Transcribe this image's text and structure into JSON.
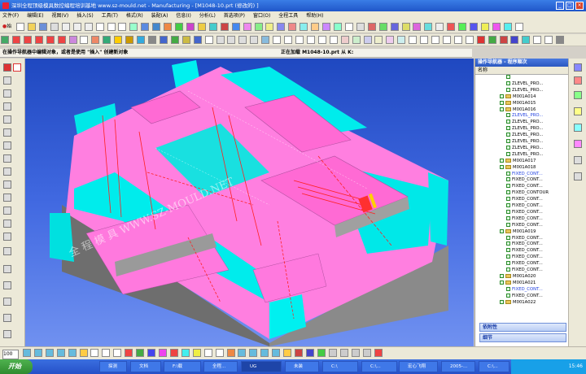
{
  "title_bar": {
    "text": "深圳全程顶级模具数控编程培训基地 www.sz-mould.net - Manufacturing - [M1048-10.prt (修改的) ]",
    "minimize": "_",
    "maximize": "□",
    "close": "×"
  },
  "menu": [
    "文件(F)",
    "编辑(E)",
    "视图(V)",
    "插入(S)",
    "工具(T)",
    "格式(R)",
    "装配(A)",
    "信息(I)",
    "分析(L)",
    "首选项(P)",
    "窗口(O)",
    "全程工具",
    "帮助(H)"
  ],
  "toolbar": {
    "start_label": "始",
    "zoom_value": "100"
  },
  "status": {
    "prompt": "在操作导航器中编辑对象，或者是使用 \"插入\" 创建新对象",
    "center": "正在加载 M1048-10.prt 从 K:"
  },
  "viewport": {
    "watermark": "全  程  模  具   WWW.SZ-MOULD.NET"
  },
  "navigator": {
    "title": "操作导航器 - 程序顺次",
    "col_name": "名称",
    "rows": [
      {
        "label": "",
        "kind": "op",
        "level": 3
      },
      {
        "label": "ZLEVEL_PRO...",
        "kind": "op",
        "level": 3
      },
      {
        "label": "ZLEVEL_PRO...",
        "kind": "op",
        "level": 3
      },
      {
        "label": "M001A014",
        "kind": "group",
        "level": 2
      },
      {
        "label": "M001A015",
        "kind": "group",
        "level": 2
      },
      {
        "label": "M001A016",
        "kind": "group",
        "level": 2
      },
      {
        "label": "ZLEVEL_PRO...",
        "kind": "op",
        "level": 3,
        "selected": true
      },
      {
        "label": "ZLEVEL_PRO...",
        "kind": "op",
        "level": 3
      },
      {
        "label": "ZLEVEL_PRO...",
        "kind": "op",
        "level": 3
      },
      {
        "label": "ZLEVEL_PRO...",
        "kind": "op",
        "level": 3
      },
      {
        "label": "ZLEVEL_PRO...",
        "kind": "op",
        "level": 3
      },
      {
        "label": "ZLEVEL_PRO...",
        "kind": "op",
        "level": 3
      },
      {
        "label": "ZLEVEL_PRO...",
        "kind": "op",
        "level": 3
      },
      {
        "label": "M001A017",
        "kind": "group",
        "level": 2
      },
      {
        "label": "M001A018",
        "kind": "group",
        "level": 2
      },
      {
        "label": "FIXED_CONT...",
        "kind": "op",
        "level": 3,
        "selected": true
      },
      {
        "label": "FIXED_CONT...",
        "kind": "op",
        "level": 3
      },
      {
        "label": "FIXED_CONT...",
        "kind": "op",
        "level": 3
      },
      {
        "label": "FIXED_CONTOUR",
        "kind": "op",
        "level": 3
      },
      {
        "label": "FIXED_CONT...",
        "kind": "op",
        "level": 3
      },
      {
        "label": "FIXED_CONT...",
        "kind": "op",
        "level": 3
      },
      {
        "label": "FIXED_CONT...",
        "kind": "op",
        "level": 3
      },
      {
        "label": "FIXED_CONT...",
        "kind": "op",
        "level": 3
      },
      {
        "label": "FIXED_CONT...",
        "kind": "op",
        "level": 3
      },
      {
        "label": "M001A019",
        "kind": "group",
        "level": 2
      },
      {
        "label": "FIXED_CONT...",
        "kind": "op",
        "level": 3
      },
      {
        "label": "FIXED_CONT...",
        "kind": "op",
        "level": 3
      },
      {
        "label": "FIXED_CONT...",
        "kind": "op",
        "level": 3
      },
      {
        "label": "FIXED_CONT...",
        "kind": "op",
        "level": 3
      },
      {
        "label": "FIXED_CONT...",
        "kind": "op",
        "level": 3
      },
      {
        "label": "FIXED_CONT...",
        "kind": "op",
        "level": 3
      },
      {
        "label": "M001A020",
        "kind": "group",
        "level": 2
      },
      {
        "label": "M001A021",
        "kind": "group",
        "level": 2
      },
      {
        "label": "FIXED_CONT...",
        "kind": "op",
        "level": 3,
        "selected": true
      },
      {
        "label": "FIXED_CONT...",
        "kind": "op",
        "level": 3
      },
      {
        "label": "M001A022",
        "kind": "group",
        "level": 2
      }
    ],
    "section_dependency": "依附性",
    "section_details": "细节"
  },
  "taskbar": {
    "start": "开始",
    "tasks": [
      "探测",
      "文档",
      "F:\\载",
      "全程...",
      "UG",
      "未装",
      "C:\\",
      "C:\\...",
      "宏心飞翔",
      "2005-...",
      "C:\\..."
    ],
    "clock": "15:46"
  }
}
